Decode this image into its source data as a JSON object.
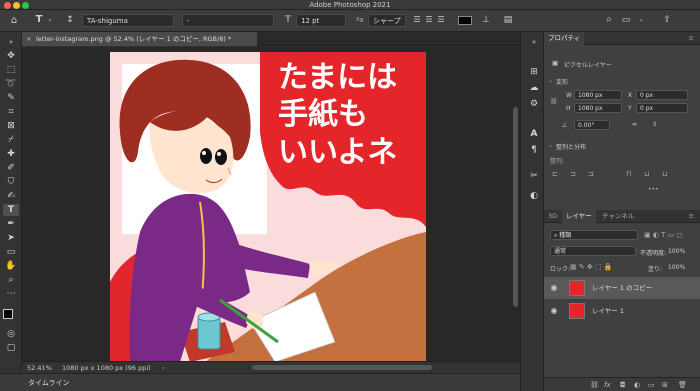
{
  "app": {
    "title": "Adobe Photoshop 2021"
  },
  "options": {
    "font_family": "TA-shiguma",
    "font_style": "-",
    "font_size": "12 pt",
    "antialias": "シャープ",
    "color_hex": "#000000"
  },
  "document": {
    "tab_label": "letter-instagram.png @ 52.4% (レイヤー 1 のコピー, RGB/8) *",
    "canvas_text": [
      "たまには",
      "手紙も",
      "いいよネ"
    ]
  },
  "status": {
    "zoom": "52.41%",
    "size": "1080 px x 1080 px (96 ppi)"
  },
  "timeline": {
    "label": "タイムライン"
  },
  "properties": {
    "tab": "プロパティ",
    "subtitle": "ピクセルレイヤー",
    "transform_label": "変形",
    "w_label": "W",
    "w_value": "1080 px",
    "x_label": "X",
    "x_value": "0 px",
    "h_label": "H",
    "h_value": "1080 px",
    "y_label": "Y",
    "y_value": "0 px",
    "angle_value": "0.00°",
    "align_label": "整列と分布",
    "align_sub": "整列:",
    "more": "•••"
  },
  "layers_panel": {
    "tabs": [
      "3D",
      "レイヤー",
      "チャンネル"
    ],
    "filter": "種類",
    "blend_mode": "通常",
    "opacity_label": "不透明度:",
    "opacity_value": "100%",
    "lock_label": "ロック:",
    "fill_label": "塗り:",
    "fill_value": "100%",
    "layers": [
      {
        "name": "レイヤー 1 のコピー",
        "selected": true
      },
      {
        "name": "レイヤー 1",
        "selected": false
      }
    ],
    "footer_icons": [
      "link-icon",
      "fx-icon",
      "mask-icon",
      "adjustment-icon",
      "folder-icon",
      "new-layer-icon",
      "trash-icon"
    ]
  },
  "colors": {
    "accent_red": "#e4262b",
    "purple": "#7a2a86",
    "desk": "#c5713f",
    "hair": "#9e2e22"
  }
}
